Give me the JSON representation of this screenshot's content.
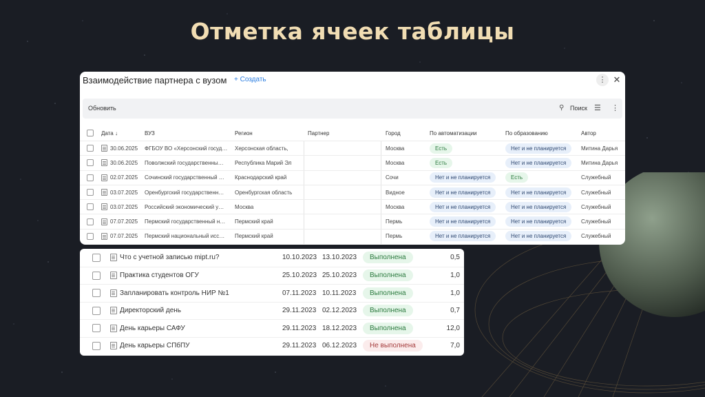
{
  "slide_title": "Отметка ячеек таблицы",
  "colors": {
    "background": "#1a1d24",
    "title": "#f1ddb3",
    "accent_link": "#2a7de1",
    "badge_green": "#e6f6ea",
    "badge_blue": "#e7effa",
    "badge_red": "#fbecec"
  },
  "card1": {
    "title": "Взаимодействие партнера с вузом",
    "create_label": "+ Создать",
    "more_icon": "more-vertical-icon",
    "close_icon": "close-icon",
    "toolbar": {
      "refresh": "Обновить",
      "search": "Поиск",
      "search_icon": "search-icon",
      "filter_icon": "filter-icon",
      "menu_icon": "more-vertical-icon"
    },
    "columns": [
      "Дата ↓",
      "ВУЗ",
      "Регион",
      "Партнер",
      "Город",
      "По автоматизации",
      "По образованию",
      "Автор"
    ],
    "rows": [
      {
        "date": "30.06.2025",
        "vuz": "ФГБОУ ВО «Херсонский госуд…",
        "region": "Херсонская область,",
        "partner": "",
        "city": "Москва",
        "auto": "Есть",
        "auto_c": "green",
        "edu": "Нет и не планируется",
        "edu_c": "blue",
        "author": "Митина Дарья"
      },
      {
        "date": "30.06.2025",
        "vuz": "Поволжский государственны…",
        "region": "Республика Марий Эл",
        "partner": "",
        "city": "Москва",
        "auto": "Есть",
        "auto_c": "green",
        "edu": "Нет и не планируется",
        "edu_c": "blue",
        "author": "Митина Дарья"
      },
      {
        "date": "02.07.2025",
        "vuz": "Сочинский государственный …",
        "region": "Краснодарский край",
        "partner": "",
        "city": "Сочи",
        "auto": "Нет и не планируется",
        "auto_c": "blue",
        "edu": "Есть",
        "edu_c": "green",
        "author": "Служебный"
      },
      {
        "date": "03.07.2025",
        "vuz": "Оренбургский государственн…",
        "region": "Оренбургская область",
        "partner": "",
        "city": "Видное",
        "auto": "Нет и не планируется",
        "auto_c": "blue",
        "edu": "Нет и не планируется",
        "edu_c": "blue",
        "author": "Служебный"
      },
      {
        "date": "03.07.2025",
        "vuz": "Российский экономический у…",
        "region": "Москва",
        "partner": "",
        "city": "Москва",
        "auto": "Нет и не планируется",
        "auto_c": "blue",
        "edu": "Нет и не планируется",
        "edu_c": "blue",
        "author": "Служебный"
      },
      {
        "date": "07.07.2025",
        "vuz": "Пермский государственный н…",
        "region": "Пермский край",
        "partner": "",
        "city": "Пермь",
        "auto": "Нет и не планируется",
        "auto_c": "blue",
        "edu": "Нет и не планируется",
        "edu_c": "blue",
        "author": "Служебный"
      },
      {
        "date": "07.07.2025",
        "vuz": "Пермский национальный исс…",
        "region": "Пермский край",
        "partner": "",
        "city": "Пермь",
        "auto": "Нет и не планируется",
        "auto_c": "blue",
        "edu": "Нет и не планируется",
        "edu_c": "blue",
        "author": "Служебный"
      }
    ]
  },
  "card2": {
    "rows": [
      {
        "name": "Что с учетной записью mipt.ru?",
        "start": "10.10.2023",
        "end": "13.10.2023",
        "status": "Выполнена",
        "status_c": "green",
        "hours": "0,5"
      },
      {
        "name": "Практика студентов ОГУ",
        "start": "25.10.2023",
        "end": "25.10.2023",
        "status": "Выполнена",
        "status_c": "green",
        "hours": "1,0"
      },
      {
        "name": "Запланировать контроль НИР №1",
        "start": "07.11.2023",
        "end": "10.11.2023",
        "status": "Выполнена",
        "status_c": "green",
        "hours": "1,0"
      },
      {
        "name": "Директорский день",
        "start": "29.11.2023",
        "end": "02.12.2023",
        "status": "Выполнена",
        "status_c": "green",
        "hours": "0,7"
      },
      {
        "name": "День карьеры САФУ",
        "start": "29.11.2023",
        "end": "18.12.2023",
        "status": "Выполнена",
        "status_c": "green",
        "hours": "12,0"
      },
      {
        "name": "День карьеры СПбПУ",
        "start": "29.11.2023",
        "end": "06.12.2023",
        "status": "Не выполнена",
        "status_c": "red",
        "hours": "7,0"
      }
    ]
  }
}
